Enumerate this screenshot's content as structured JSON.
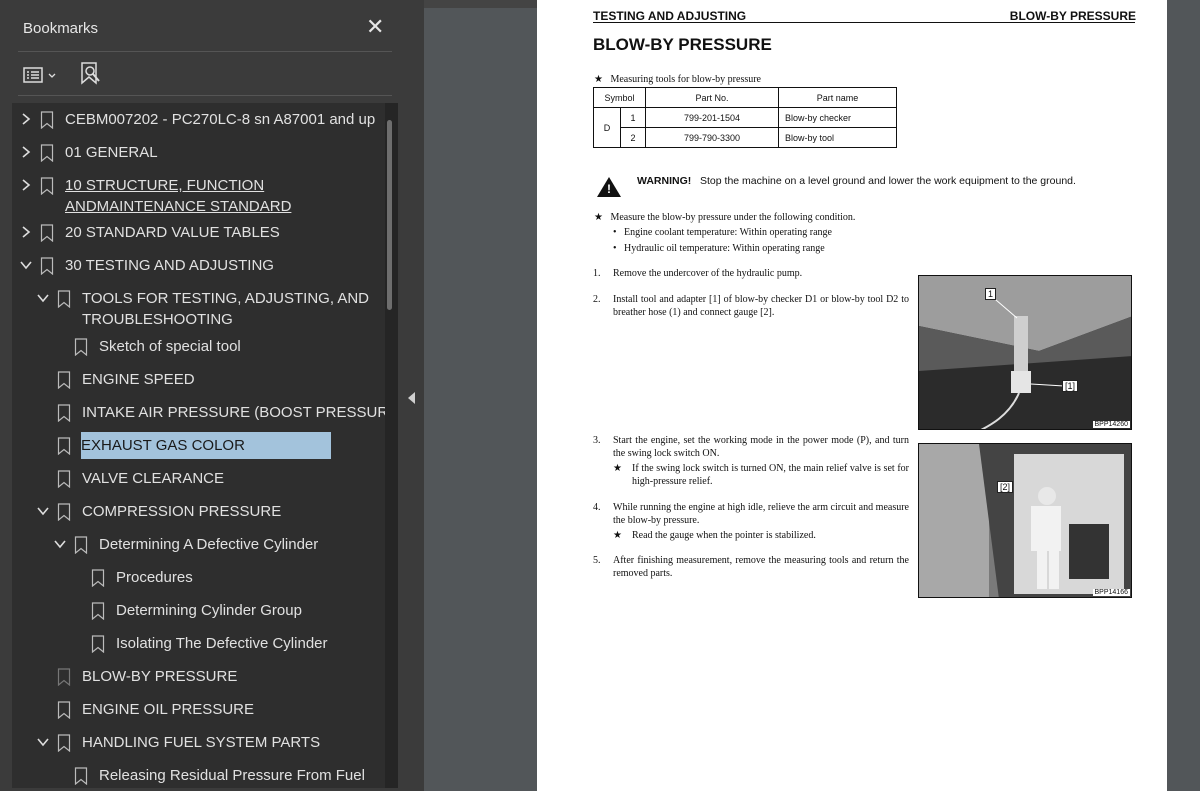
{
  "sidebar": {
    "title": "Bookmarks",
    "close_icon": "close-icon",
    "toolbar": {
      "options_icon": "list-options-icon",
      "find_icon": "find-bookmark-icon"
    },
    "items": [
      {
        "label": "CEBM007202 - PC270LC-8 sn A87001 and up",
        "level": 0,
        "expand": "collapsed"
      },
      {
        "label": "01 GENERAL",
        "level": 0,
        "expand": "collapsed"
      },
      {
        "label": "10 STRUCTURE, FUNCTION",
        "label2": "ANDMAINTENANCE STANDARD",
        "level": 0,
        "expand": "collapsed"
      },
      {
        "label": "20 STANDARD VALUE TABLES",
        "level": 0,
        "expand": "collapsed"
      },
      {
        "label": "30 TESTING AND ADJUSTING",
        "level": 0,
        "expand": "expanded"
      },
      {
        "label": "TOOLS FOR TESTING, ADJUSTING, AND",
        "label2": "TROUBLESHOOTING",
        "level": 1,
        "expand": "expanded"
      },
      {
        "label": "Sketch of special tool",
        "level": 2,
        "expand": "none"
      },
      {
        "label": "ENGINE SPEED",
        "level": 1,
        "expand": "none"
      },
      {
        "label": "INTAKE AIR PRESSURE (BOOST PRESSURE)",
        "level": 1,
        "expand": "none"
      },
      {
        "label": "EXHAUST GAS COLOR",
        "level": 1,
        "expand": "none",
        "selected": true
      },
      {
        "label": "VALVE CLEARANCE",
        "level": 1,
        "expand": "none"
      },
      {
        "label": "COMPRESSION PRESSURE",
        "level": 1,
        "expand": "expanded"
      },
      {
        "label": "Determining A Defective Cylinder",
        "level": 2,
        "expand": "expanded"
      },
      {
        "label": "Procedures",
        "level": 3,
        "expand": "none"
      },
      {
        "label": "Determining Cylinder Group",
        "level": 3,
        "expand": "none"
      },
      {
        "label": "Isolating The Defective Cylinder",
        "level": 3,
        "expand": "none"
      },
      {
        "label": "BLOW-BY PRESSURE",
        "level": 1,
        "expand": "none"
      },
      {
        "label": "ENGINE OIL PRESSURE",
        "level": 1,
        "expand": "none"
      },
      {
        "label": "HANDLING FUEL SYSTEM PARTS",
        "level": 1,
        "expand": "expanded"
      },
      {
        "label": "Releasing Residual Pressure From Fuel",
        "level": 2,
        "expand": "none"
      }
    ]
  },
  "page": {
    "header_left": "TESTING AND ADJUSTING",
    "header_right": "BLOW-BY PRESSURE",
    "title": "BLOW-BY PRESSURE",
    "tools_intro": "Measuring tools for blow-by pressure",
    "table": {
      "headers": [
        "Symbol",
        "Part No.",
        "Part name"
      ],
      "group": "D",
      "rows": [
        {
          "num": "1",
          "part_no": "799-201-1504",
          "part_name": "Blow-by checker"
        },
        {
          "num": "2",
          "part_no": "799-790-3300",
          "part_name": "Blow-by tool"
        }
      ]
    },
    "warning_label": "WARNING!",
    "warning_text": "Stop the machine on a level ground and lower the work equipment to the ground.",
    "condition_intro": "Measure the blow-by pressure under the following condition.",
    "conditions": [
      "Engine coolant temperature: Within operating range",
      "Hydraulic oil temperature: Within operating range"
    ],
    "steps": [
      {
        "num": "1.",
        "text": "Remove the undercover of the hydraulic pump."
      },
      {
        "num": "2.",
        "text": "Install tool and adapter [1] of blow-by checker D1 or blow-by tool D2 to breather hose (1) and connect gauge [2]."
      },
      {
        "num": "3.",
        "text": "Start the engine, set the working mode in the power mode (P), and turn the swing lock switch ON.",
        "note": "If the swing lock switch is turned ON, the main relief valve is set for high-pressure relief."
      },
      {
        "num": "4.",
        "text": "While running the engine at high idle, relieve the arm circuit and measure the blow-by pressure.",
        "note": "Read the gauge when the pointer is stabilized."
      },
      {
        "num": "5.",
        "text": "After finishing measurement, remove the measuring tools and return the removed parts."
      }
    ],
    "photo1": {
      "tag1": "1",
      "tag2": "[1]",
      "code": "BPP14260"
    },
    "photo2": {
      "tag": "[2]",
      "code": "BPP14166"
    }
  }
}
